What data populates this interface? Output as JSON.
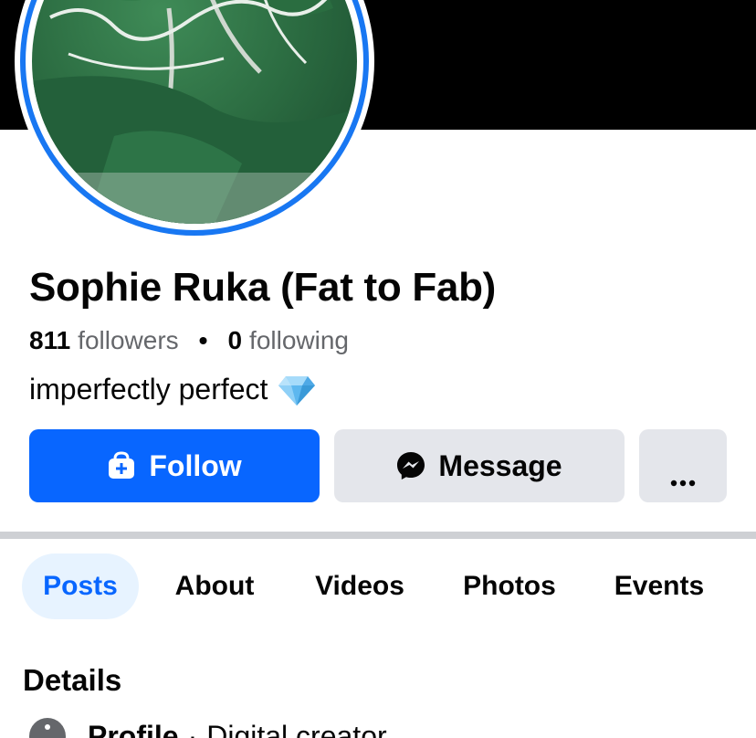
{
  "profile": {
    "name": "Sophie Ruka (Fat to Fab)",
    "followers_count": "811",
    "followers_label": "followers",
    "separator": "•",
    "following_count": "0",
    "following_label": "following",
    "bio": "imperfectly perfect",
    "bio_emoji": "gem-stone-icon"
  },
  "actions": {
    "follow_label": "Follow",
    "follow_icon": "add-friend-icon",
    "message_label": "Message",
    "message_icon": "messenger-icon",
    "more_icon": "more-options-icon"
  },
  "tabs": [
    {
      "label": "Posts",
      "active": true
    },
    {
      "label": "About",
      "active": false
    },
    {
      "label": "Videos",
      "active": false
    },
    {
      "label": "Photos",
      "active": false
    },
    {
      "label": "Events",
      "active": false
    }
  ],
  "details": {
    "heading": "Details",
    "rows": [
      {
        "icon": "info-icon",
        "label": "Profile",
        "separator": "·",
        "value": "Digital creator"
      }
    ]
  },
  "colors": {
    "accent": "#0866ff",
    "story_ring": "#1877f2",
    "secondary_button": "#e4e6eb",
    "active_tab_bg": "#e7f3ff",
    "cover": "#000000"
  }
}
